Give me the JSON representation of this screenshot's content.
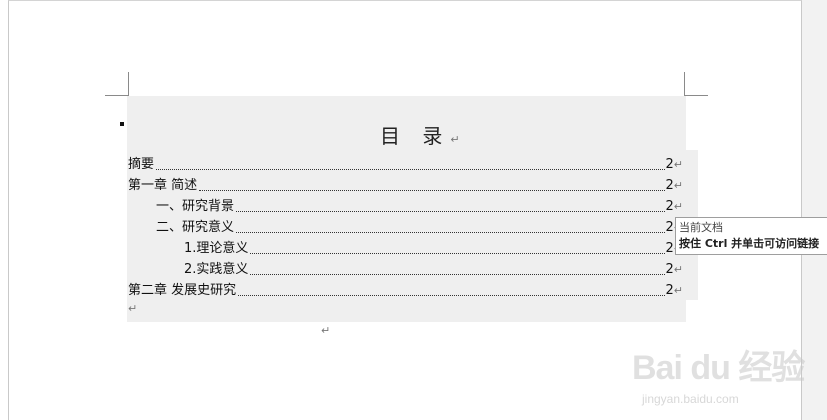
{
  "document": {
    "title": "目 录",
    "title_mark": "↵",
    "paragraph_mark": "↵",
    "toc": [
      {
        "label": "摘要",
        "page": "2"
      },
      {
        "label": "第一章  简述",
        "page": "2"
      },
      {
        "label": "一、研究背景",
        "page": "2"
      },
      {
        "label": "二、研究意义",
        "page": "2"
      },
      {
        "label": "1.理论意义",
        "page": "2"
      },
      {
        "label": "2.实践意义",
        "page": "2"
      },
      {
        "label": "第二章  发展史研究",
        "page": "2"
      }
    ]
  },
  "tooltip": {
    "line1": "当前文档",
    "line2": "按住 Ctrl 并单击可访问链接"
  },
  "watermark": {
    "logo": "Bai du 经验",
    "url": "jingyan.baidu.com"
  },
  "colors": {
    "field_shading": "#efefef",
    "page": "#ffffff"
  }
}
